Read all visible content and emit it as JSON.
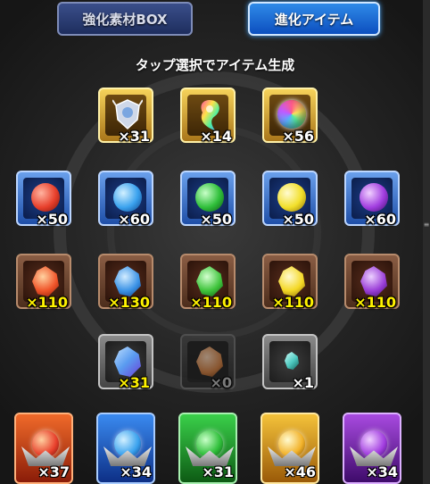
{
  "tabs": {
    "enhance_box": "強化素材BOX",
    "evolution_items": "進化アイテム"
  },
  "header": "タップ選択でアイテム生成",
  "rows": {
    "special": [
      {
        "icon": "crest-icon",
        "count": "×31"
      },
      {
        "icon": "rainbow-tear-icon",
        "count": "×14"
      },
      {
        "icon": "rainbow-orb-icon",
        "count": "×56"
      }
    ],
    "orbs": [
      {
        "icon": "fire-orb-icon",
        "color": "#e8402c",
        "count": "×50"
      },
      {
        "icon": "water-orb-icon",
        "color": "#3aa2ee",
        "count": "×60"
      },
      {
        "icon": "wood-orb-icon",
        "color": "#2fbf3a",
        "count": "×50"
      },
      {
        "icon": "light-orb-icon",
        "color": "#f2df2a",
        "count": "×50"
      },
      {
        "icon": "dark-orb-icon",
        "color": "#a23ee0",
        "count": "×60"
      }
    ],
    "stones": [
      {
        "icon": "fire-stone-icon",
        "color": "#f0552a",
        "count": "×110"
      },
      {
        "icon": "water-stone-icon",
        "color": "#3c93e6",
        "count": "×130"
      },
      {
        "icon": "wood-stone-icon",
        "color": "#3fc43c",
        "count": "×110"
      },
      {
        "icon": "light-stone-icon",
        "color": "#f4d825",
        "count": "×110"
      },
      {
        "icon": "dark-stone-icon",
        "color": "#9b3fd8",
        "count": "×110"
      }
    ],
    "crystals": [
      {
        "icon": "blue-crystal-icon",
        "color": "#5a9cf0",
        "count": "×31"
      },
      {
        "icon": "amber-crystal-icon",
        "color": "#d07a3a",
        "count": "×0"
      },
      {
        "icon": "teal-crystal-icon",
        "color": "#4ec9c0",
        "count": "×1"
      }
    ],
    "medals": [
      {
        "icon": "fire-medal-icon",
        "color": "#e8402c",
        "count": "×37"
      },
      {
        "icon": "water-medal-icon",
        "color": "#3aa2ee",
        "count": "×34"
      },
      {
        "icon": "wood-medal-icon",
        "color": "#2fbf3a",
        "count": "×31"
      },
      {
        "icon": "light-medal-icon",
        "color": "#f2b22a",
        "count": "×46"
      },
      {
        "icon": "dark-medal-icon",
        "color": "#a23ee0",
        "count": "×34"
      }
    ]
  }
}
